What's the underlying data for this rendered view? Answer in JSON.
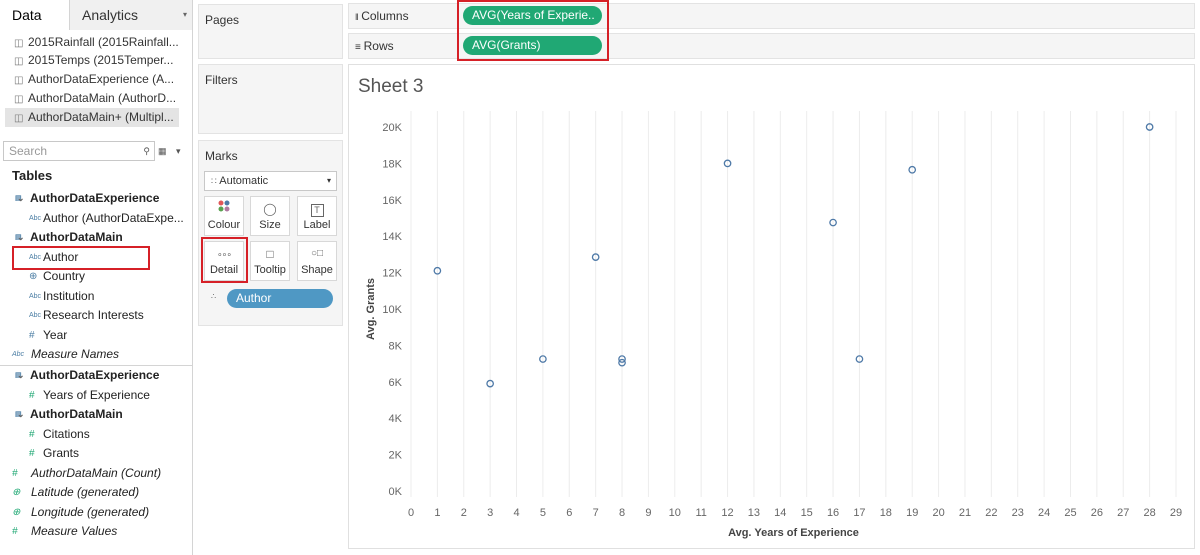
{
  "tabs": {
    "data": "Data",
    "analytics": "Analytics"
  },
  "sources": [
    "2015Rainfall (2015Rainfall...",
    "2015Temps (2015Temper...",
    "AuthorDataExperience (A...",
    "AuthorDataMain (AuthorD...",
    "AuthorDataMain+ (Multipl..."
  ],
  "search": {
    "placeholder": "Search"
  },
  "tables_header": "Tables",
  "fields": [
    {
      "label": "AuthorDataExperience",
      "kind": "group",
      "icon": "table-icon"
    },
    {
      "label": "Author (AuthorDataExpe...",
      "kind": "dim",
      "icon": "abc-icon"
    },
    {
      "label": "AuthorDataMain",
      "kind": "group",
      "icon": "table-icon"
    },
    {
      "label": "Author",
      "kind": "dim",
      "icon": "abc-icon"
    },
    {
      "label": "Country",
      "kind": "dim",
      "icon": "globe-icon"
    },
    {
      "label": "Institution",
      "kind": "dim",
      "icon": "abc-icon"
    },
    {
      "label": "Research Interests",
      "kind": "dim",
      "icon": "abc-icon"
    },
    {
      "label": "Year",
      "kind": "dim",
      "icon": "hash-icon"
    },
    {
      "label": "Measure Names",
      "kind": "special",
      "icon": "abc-icon"
    },
    {
      "label": "AuthorDataExperience",
      "kind": "group",
      "icon": "table-icon"
    },
    {
      "label": "Years of Experience",
      "kind": "measure",
      "icon": "hash-icon"
    },
    {
      "label": "AuthorDataMain",
      "kind": "group",
      "icon": "table-icon"
    },
    {
      "label": "Citations",
      "kind": "measure",
      "icon": "hash-icon"
    },
    {
      "label": "Grants",
      "kind": "measure",
      "icon": "hash-icon"
    },
    {
      "label": "AuthorDataMain (Count)",
      "kind": "special",
      "icon": "hash-icon"
    },
    {
      "label": "Latitude (generated)",
      "kind": "special",
      "icon": "globe-icon"
    },
    {
      "label": "Longitude (generated)",
      "kind": "special",
      "icon": "globe-icon"
    },
    {
      "label": "Measure Values",
      "kind": "special",
      "icon": "hash-icon"
    }
  ],
  "cards": {
    "pages": "Pages",
    "filters": "Filters",
    "marks": "Marks"
  },
  "marks": {
    "type": "Automatic",
    "colour": "Colour",
    "size": "Size",
    "label": "Label",
    "detail": "Detail",
    "tooltip": "Tooltip",
    "shape": "Shape",
    "detail_pill": "Author"
  },
  "shelves": {
    "columns_label": "Columns",
    "rows_label": "Rows",
    "columns_pill": "AVG(Years of Experie..",
    "rows_pill": "AVG(Grants)"
  },
  "sheet": {
    "title": "Sheet 3"
  },
  "colors": {
    "pill_green": "#20a874",
    "pill_blue": "#4f98c4",
    "highlight": "#d62027",
    "mark": "#4e79a7"
  },
  "chart_data": {
    "type": "scatter",
    "xlabel": "Avg. Years of Experience",
    "ylabel": "Avg. Grants",
    "xlim": [
      0,
      29
    ],
    "ylim": [
      0,
      20000
    ],
    "x_ticks": [
      0,
      1,
      2,
      3,
      4,
      5,
      6,
      7,
      8,
      9,
      10,
      11,
      12,
      13,
      14,
      15,
      16,
      17,
      18,
      19,
      20,
      21,
      22,
      23,
      24,
      25,
      26,
      27,
      28,
      29
    ],
    "y_ticks": [
      "0K",
      "2K",
      "4K",
      "6K",
      "8K",
      "10K",
      "12K",
      "14K",
      "16K",
      "18K",
      "20K"
    ],
    "grid": "vertical",
    "points": [
      {
        "x": 1,
        "y": 12100
      },
      {
        "x": 3,
        "y": 5900
      },
      {
        "x": 5,
        "y": 7250
      },
      {
        "x": 7,
        "y": 12850
      },
      {
        "x": 8,
        "y": 7250
      },
      {
        "x": 8,
        "y": 7050
      },
      {
        "x": 12,
        "y": 18000
      },
      {
        "x": 16,
        "y": 14750
      },
      {
        "x": 17,
        "y": 7250
      },
      {
        "x": 19,
        "y": 17650
      },
      {
        "x": 28,
        "y": 20000
      }
    ]
  }
}
